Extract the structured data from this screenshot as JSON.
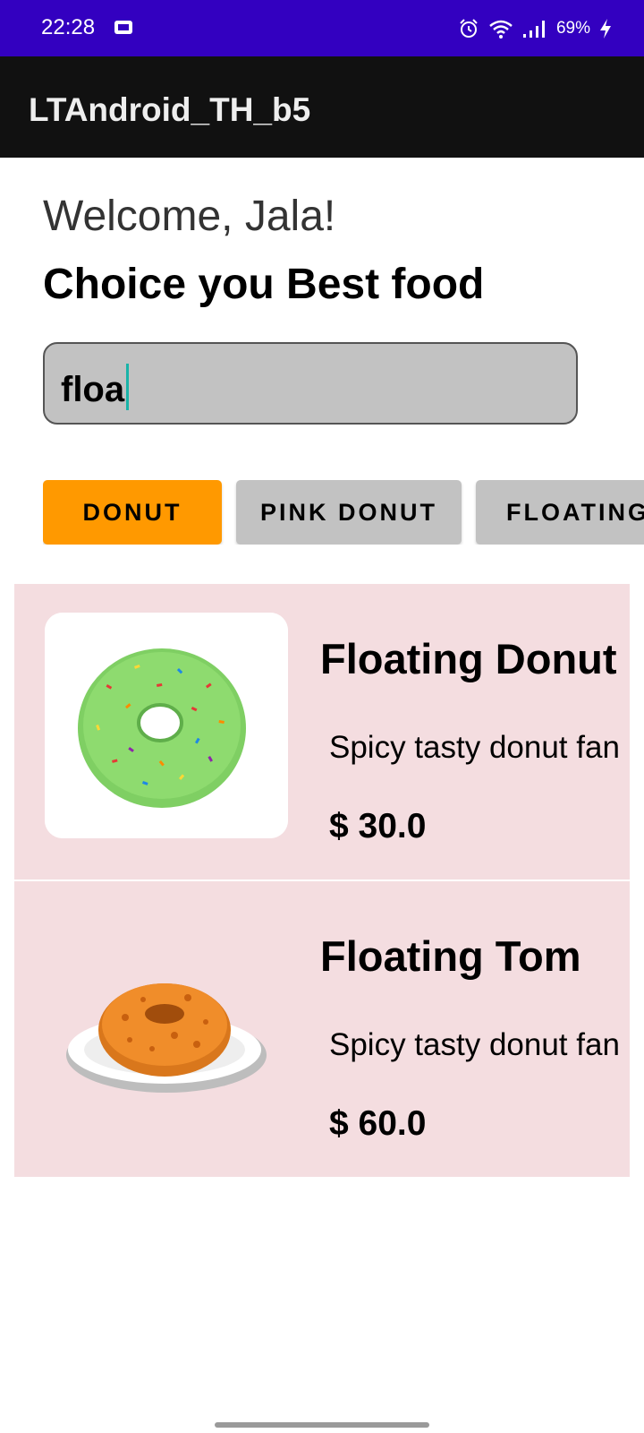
{
  "status_bar": {
    "time": "22:28",
    "battery": "69%",
    "background_color": "#3300c0",
    "icons": [
      "sim-icon",
      "alarm-icon",
      "wifi-icon",
      "signal-icon",
      "charging-icon"
    ]
  },
  "app_bar": {
    "title": "LTAndroid_TH_b5",
    "background_color": "#111111"
  },
  "header": {
    "welcome": "Welcome, Jala!",
    "subtitle": "Choice you Best food"
  },
  "search": {
    "value": "floa",
    "background_color": "#c2c2c2"
  },
  "categories": [
    {
      "label": "DONUT",
      "selected": true,
      "color": "#ff9900"
    },
    {
      "label": "PINK DONUT",
      "selected": false,
      "color": "#c2c2c2"
    },
    {
      "label": "FLOATING",
      "selected": false,
      "color": "#c2c2c2"
    }
  ],
  "products": [
    {
      "name": "Floating Donut",
      "description": "Spicy tasty donut fan",
      "price": "$ 30.0",
      "image_icon": "green-sprinkle-donut-image"
    },
    {
      "name": "Floating Tom",
      "description": "Spicy tasty donut fan",
      "price": "$ 60.0",
      "image_icon": "crumb-donut-on-plate-image"
    }
  ],
  "card_color": "#f4dde0"
}
